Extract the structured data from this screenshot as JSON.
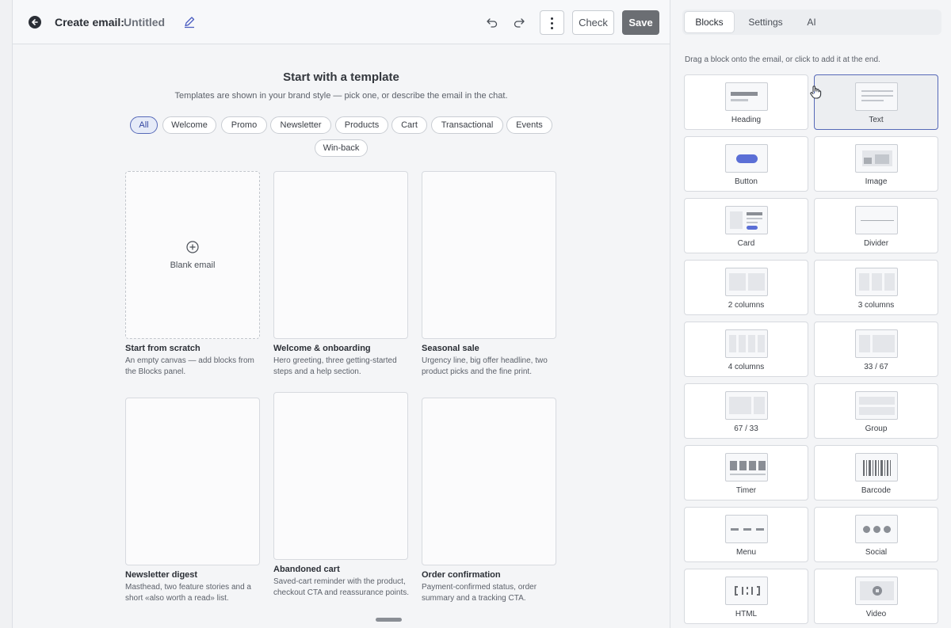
{
  "header": {
    "title_label": "Create email:",
    "title_name": "Untitled",
    "check_label": "Check",
    "save_label": "Save"
  },
  "main": {
    "title": "Start with a template",
    "subtitle": "Templates are shown in your brand style — pick one, or describe the email in the chat.",
    "filters": [
      {
        "label": "All",
        "active": true
      },
      {
        "label": "Welcome"
      },
      {
        "label": "Promo"
      },
      {
        "label": "Newsletter"
      },
      {
        "label": "Products"
      },
      {
        "label": "Cart"
      },
      {
        "label": "Transactional"
      },
      {
        "label": "Events"
      },
      {
        "label": "Win-back"
      }
    ],
    "blank_label": "Blank email",
    "templates": [
      {
        "name": "Start from scratch",
        "desc": "An empty canvas — add blocks from the Blocks panel."
      },
      {
        "name": "Welcome & onboarding",
        "desc": "Hero greeting, three getting-started steps and a help section."
      },
      {
        "name": "Seasonal sale",
        "desc": "Urgency line, big offer headline, two product picks and the fine print."
      },
      {
        "name": "Newsletter digest",
        "desc": "Masthead, two feature stories and a short «also worth a read» list."
      },
      {
        "name": "Abandoned cart",
        "desc": "Saved-cart reminder with the product, checkout CTA and reassurance points."
      },
      {
        "name": "Order confirmation",
        "desc": "Payment-confirmed status, order summary and a tracking CTA."
      }
    ]
  },
  "panel": {
    "tabs": [
      {
        "label": "Blocks",
        "active": true
      },
      {
        "label": "Settings"
      },
      {
        "label": "AI"
      }
    ],
    "hint": "Drag a block onto the email, or click to add it at the end.",
    "blocks": [
      {
        "label": "Heading",
        "icon": "heading-block-icon"
      },
      {
        "label": "Text",
        "icon": "text-block-icon",
        "selected": true
      },
      {
        "label": "Button",
        "icon": "button-block-icon"
      },
      {
        "label": "Image",
        "icon": "image-block-icon"
      },
      {
        "label": "Card",
        "icon": "card-block-icon"
      },
      {
        "label": "Divider",
        "icon": "divider-block-icon"
      },
      {
        "label": "2 columns",
        "icon": "two-columns-icon"
      },
      {
        "label": "3 columns",
        "icon": "three-columns-icon"
      },
      {
        "label": "4 columns",
        "icon": "four-columns-icon"
      },
      {
        "label": "33 / 67",
        "icon": "columns-33-67-icon"
      },
      {
        "label": "67 / 33",
        "icon": "columns-67-33-icon"
      },
      {
        "label": "Group",
        "icon": "group-block-icon"
      },
      {
        "label": "Timer",
        "icon": "timer-block-icon"
      },
      {
        "label": "Barcode",
        "icon": "barcode-block-icon"
      },
      {
        "label": "Menu",
        "icon": "menu-block-icon"
      },
      {
        "label": "Social",
        "icon": "social-block-icon"
      },
      {
        "label": "HTML",
        "icon": "html-block-icon"
      },
      {
        "label": "Video",
        "icon": "video-block-icon"
      }
    ]
  },
  "colors": {
    "accent": "#5669b8",
    "button_accent": "#5b6fd6",
    "save_bg": "#6b6e73"
  }
}
